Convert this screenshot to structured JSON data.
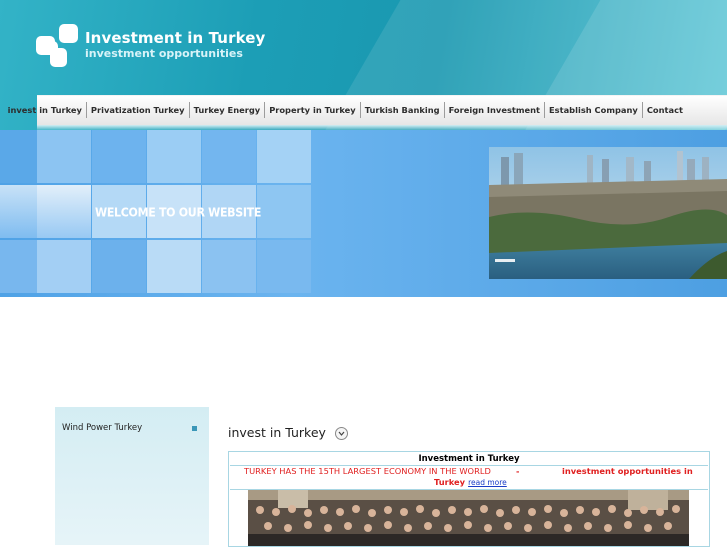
{
  "header": {
    "title": "Investment in Turkey",
    "subtitle": "investment opportunities"
  },
  "nav": {
    "items": [
      {
        "label": "invest in Turkey"
      },
      {
        "label": "Privatization Turkey"
      },
      {
        "label": "Turkey Energy"
      },
      {
        "label": "Property in Turkey"
      },
      {
        "label": "Turkish Banking"
      },
      {
        "label": "Foreign Investment"
      },
      {
        "label": "Establish Company"
      },
      {
        "label": "Contact"
      }
    ]
  },
  "banner": {
    "welcome_text": "WELCOME TO OUR WEBSITE"
  },
  "sidebar": {
    "items": [
      {
        "label": "Wind Power Turkey"
      }
    ]
  },
  "main": {
    "heading": "invest in Turkey",
    "table": {
      "header": "Investment in Turkey",
      "left_text": "TURKEY HAS THE 15TH LARGEST ECONOMY IN THE WORLD",
      "separator": "-",
      "right_text_line1": "investment opportunities in",
      "right_text_line2": "Turkey",
      "read_more": "read more"
    }
  },
  "colors": {
    "header_bg": "#1c9eb6",
    "banner_bg": "#4fa2e6",
    "highlight_red": "#e02020",
    "link_blue": "#1a3cc7",
    "sidebar_bg": "#d4edf3"
  }
}
